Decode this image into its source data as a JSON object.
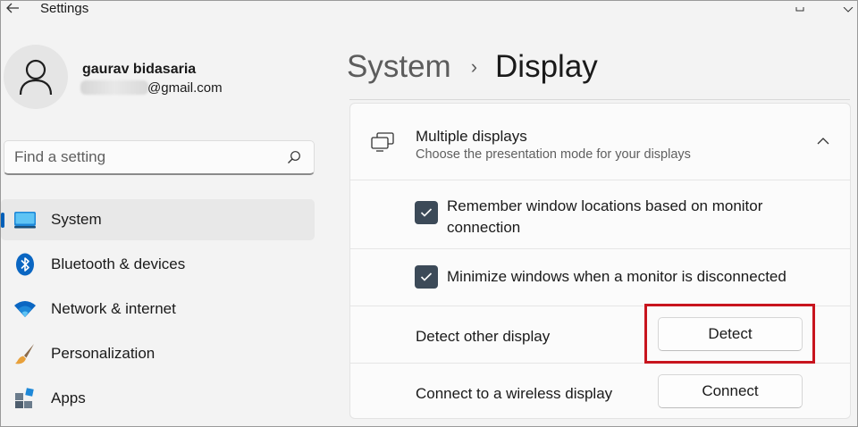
{
  "window": {
    "title": "Settings"
  },
  "profile": {
    "name": "gaurav bidasaria",
    "email_suffix": "@gmail.com"
  },
  "search": {
    "placeholder": "Find a setting"
  },
  "nav": {
    "items": [
      {
        "label": "System",
        "icon": "system-display-icon",
        "active": true
      },
      {
        "label": "Bluetooth & devices",
        "icon": "bluetooth-icon"
      },
      {
        "label": "Network & internet",
        "icon": "wifi-icon"
      },
      {
        "label": "Personalization",
        "icon": "brush-icon"
      },
      {
        "label": "Apps",
        "icon": "apps-icon"
      }
    ]
  },
  "header": {
    "parent": "System",
    "separator": "›",
    "current": "Display"
  },
  "card": {
    "title": "Multiple displays",
    "subtitle": "Choose the presentation mode for your displays",
    "options": [
      {
        "line1": "Remember window locations based on monitor",
        "line2": "connection",
        "checked": true
      },
      {
        "line1": "Minimize windows when a monitor is disconnected",
        "checked": true
      }
    ],
    "detect": {
      "label": "Detect other display",
      "button": "Detect"
    },
    "connect": {
      "label": "Connect to a wireless display",
      "button": "Connect"
    }
  },
  "colors": {
    "accent": "#005fb8",
    "highlight": "#c8141e",
    "checkbox": "#3c4a58"
  }
}
